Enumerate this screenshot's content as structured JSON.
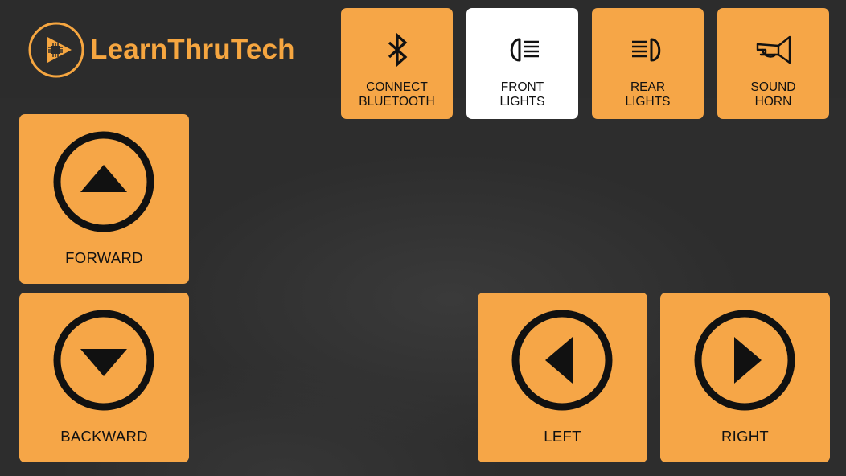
{
  "brand": {
    "name": "LearnThruTech",
    "accent": "#f6a640"
  },
  "toolbar": [
    {
      "id": "bluetooth",
      "label": "CONNECT\nBLUETOOTH",
      "icon": "bluetooth-icon",
      "active": false
    },
    {
      "id": "front-lights",
      "label": "FRONT\nLIGHTS",
      "icon": "headlight-front-icon",
      "active": true
    },
    {
      "id": "rear-lights",
      "label": "REAR\nLIGHTS",
      "icon": "headlight-rear-icon",
      "active": false
    },
    {
      "id": "horn",
      "label": "SOUND\nHORN",
      "icon": "horn-icon",
      "active": false
    }
  ],
  "controls": {
    "forward": {
      "label": "FORWARD",
      "icon": "arrow-up-circle-icon"
    },
    "backward": {
      "label": "BACKWARD",
      "icon": "arrow-down-circle-icon"
    },
    "left": {
      "label": "LEFT",
      "icon": "arrow-left-circle-icon"
    },
    "right": {
      "label": "RIGHT",
      "icon": "arrow-right-circle-icon"
    }
  },
  "colors": {
    "button": "#f6a647",
    "button_active": "#ffffff",
    "background": "#2d2d2d"
  }
}
